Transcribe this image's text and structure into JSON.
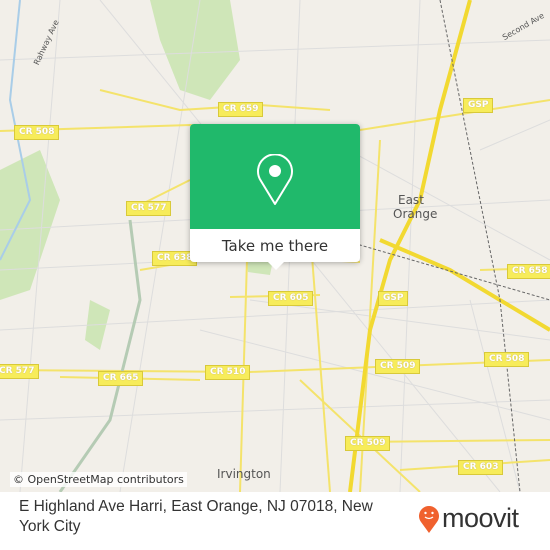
{
  "map": {
    "shields": [
      {
        "label": "CR 659"
      },
      {
        "label": "CR 508"
      },
      {
        "label": "CR 577"
      },
      {
        "label": "CR 638"
      },
      {
        "label": "CR 605"
      },
      {
        "label": "CR 510"
      },
      {
        "label": "CR 665"
      },
      {
        "label": "CR 577"
      },
      {
        "label": "CR 509"
      },
      {
        "label": "CR 508"
      },
      {
        "label": "CR 509"
      },
      {
        "label": "CR 603"
      },
      {
        "label": "CR 658"
      },
      {
        "label": "GSP"
      },
      {
        "label": "GSP"
      }
    ],
    "places": {
      "east": "East",
      "orange": "Orange",
      "irvington": "Irvington",
      "rahway": "Rahway Ave",
      "second": "Second Ave"
    },
    "attribution": "© OpenStreetMap contributors"
  },
  "popup": {
    "icon": "map-pin-icon",
    "button_label": "Take me there",
    "color": "#20b96b"
  },
  "footer": {
    "address": "E Highland Ave Harri, East Orange, NJ 07018, New York City",
    "logo_text": "moovit",
    "logo_color": "#f0612e"
  }
}
